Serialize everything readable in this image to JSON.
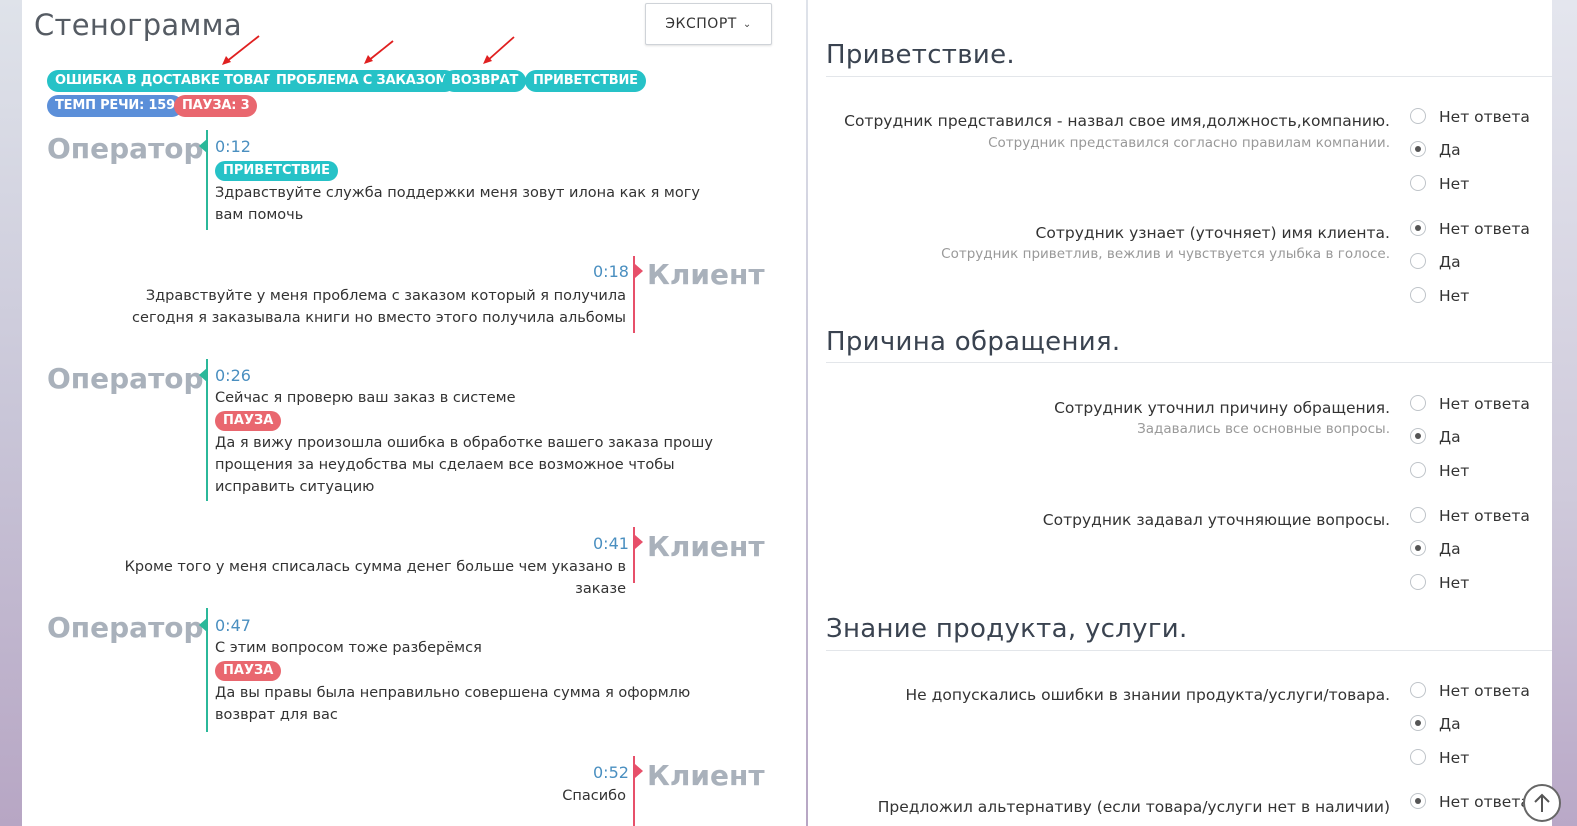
{
  "transcript": {
    "title": "Стенограмма",
    "export_label": "ЭКСПОРТ",
    "tags": [
      "ОШИБКА В ДОСТАВКЕ ТОВАРА",
      "ПРОБЛЕМА С ЗАКАЗОМ",
      "ВОЗВРАТ",
      "ПРИВЕТСТВИЕ"
    ],
    "speech_rate": "ТЕМП РЕЧИ: 159",
    "pause_count": "ПАУЗА: 3",
    "operator_label": "Оператор",
    "client_label": "Клиент",
    "messages": [
      {
        "time": "0:12",
        "tag": "ПРИВЕТСТВИЕ",
        "text": "Здравствуйте служба поддержки меня зовут илона как я могу вам помочь"
      },
      {
        "time": "0:18",
        "text": "Здравствуйте у меня проблема с заказом который я получила сегодня я заказывала книги но вместо этого получила альбомы"
      },
      {
        "time": "0:26",
        "text": "Сейчас я проверю ваш заказ в системе",
        "tag": "ПАУЗА",
        "text2": "Да я вижу произошла ошибка в обработке вашего заказа прошу прощения за неудобства мы сделаем все возможное чтобы исправить ситуацию"
      },
      {
        "time": "0:41",
        "text": "Кроме того у меня списалась сумма денег больше чем указано в заказе"
      },
      {
        "time": "0:47",
        "text": "С этим вопросом тоже разберёмся",
        "tag": "ПАУЗА",
        "text2": "Да вы правы была неправильно совершена сумма я оформлю возврат для вас"
      },
      {
        "time": "0:52",
        "text": "Спасибо"
      }
    ]
  },
  "evaluation": {
    "options": [
      "Нет ответа",
      "Да",
      "Нет"
    ],
    "sections": [
      {
        "title": "Приветствие.",
        "questions": [
          {
            "text": "Сотрудник представился - назвал свое имя,должность,компанию.",
            "hint": "Сотрудник представился согласно правилам компании.",
            "selected": "Да"
          },
          {
            "text": "Сотрудник узнает (уточняет) имя клиента.",
            "hint": "Сотрудник приветлив, вежлив и чувствуется улыбка в голосе.",
            "selected": "Нет ответа"
          }
        ]
      },
      {
        "title": "Причина обращения.",
        "questions": [
          {
            "text": "Сотрудник уточнил причину обращения.",
            "hint": "Задавались все основные вопросы.",
            "selected": "Да"
          },
          {
            "text": "Сотрудник задавал уточняющие вопросы.",
            "hint": "",
            "selected": "Да"
          }
        ]
      },
      {
        "title": "Знание продукта, услуги.",
        "questions": [
          {
            "text": "Не допускались ошибки в знании продукта/услуги/товара.",
            "hint": "",
            "selected": "Да"
          },
          {
            "text": "Предложил альтернативу (если товара/услуги нет в наличии)",
            "hint": "",
            "selected": "Нет ответа"
          }
        ]
      }
    ]
  },
  "colors": {
    "teal": "#26c2c7",
    "blue": "#5b8fd9",
    "red": "#e9676f",
    "operator_line": "#2bb89a",
    "client_line": "#e7506a"
  },
  "icons": [
    "chevron-down-icon",
    "scroll-to-top-icon",
    "red-arrow-annotation"
  ]
}
